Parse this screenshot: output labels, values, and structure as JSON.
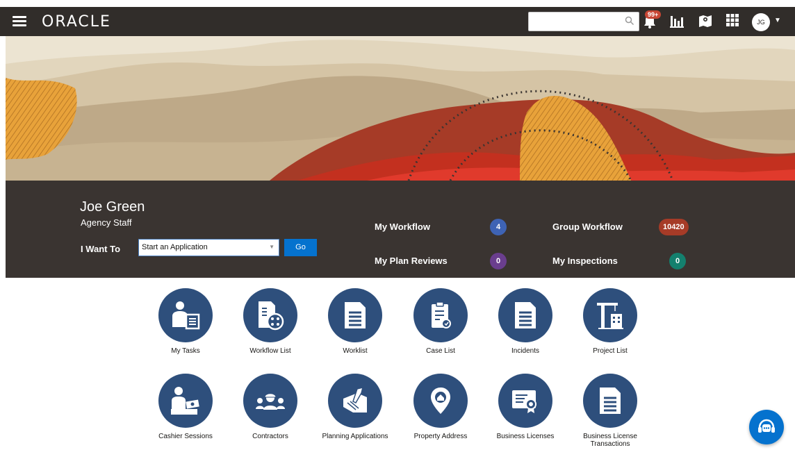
{
  "header": {
    "logo_text": "ORACLE",
    "search_placeholder": "",
    "notification_badge": "99+",
    "user_initials": "JG"
  },
  "profile": {
    "name": "Joe Green",
    "role": "Agency Staff",
    "i_want_to_label": "I Want To",
    "selected_action": "Start an Application",
    "go_label": "Go"
  },
  "workflow": {
    "my_workflow_label": "My Workflow",
    "my_workflow_count": "4",
    "group_workflow_label": "Group Workflow",
    "group_workflow_count": "10420",
    "my_plan_reviews_label": "My Plan Reviews",
    "my_plan_reviews_count": "0",
    "my_inspections_label": "My Inspections",
    "my_inspections_count": "0"
  },
  "tiles": {
    "row1": [
      {
        "label": "My Tasks",
        "icon": "tasks-icon"
      },
      {
        "label": "Workflow List",
        "icon": "workflow-icon"
      },
      {
        "label": "Worklist",
        "icon": "document-icon"
      },
      {
        "label": "Case List",
        "icon": "clipboard-icon"
      },
      {
        "label": "Incidents",
        "icon": "document-icon"
      },
      {
        "label": "Project List",
        "icon": "crane-icon"
      }
    ],
    "row2": [
      {
        "label": "Cashier Sessions",
        "icon": "cashier-icon"
      },
      {
        "label": "Contractors",
        "icon": "contractors-icon"
      },
      {
        "label": "Planning Applications",
        "icon": "blueprint-icon"
      },
      {
        "label": "Property Address",
        "icon": "location-pin-icon"
      },
      {
        "label": "Business Licenses",
        "icon": "certificate-icon"
      },
      {
        "label": "Business License Transactions",
        "icon": "document-icon"
      }
    ]
  },
  "colors": {
    "header_bg": "#312d2a",
    "profile_bg": "#3a3431",
    "tile_circle": "#2e4f7c",
    "go_button": "#0572ce",
    "badge_blue": "#3e63b4",
    "badge_red": "#a63b27",
    "badge_purple": "#6a3e8e",
    "badge_teal": "#14806e"
  }
}
